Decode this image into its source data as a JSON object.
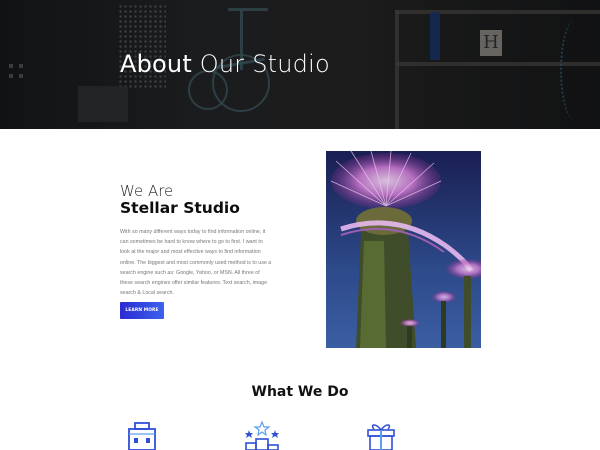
{
  "hero": {
    "title_bold": "About",
    "title_rest": " Our Studio"
  },
  "about": {
    "eyebrow": "We Are",
    "name": "Stellar Studio",
    "description": "With so many different ways today to find information online, it can sometimes be hard to know where to go to first. I want to look at the major and most effective ways to find information online. The biggest and most commonly used method is to use a search engine such as: Google, Yahoo, or MSN. All three of these search engines offer similar features: Text search, image search & Local search.",
    "button_label": "LEARN MORE"
  },
  "services": {
    "title": "What We Do",
    "icons": [
      "building-icon",
      "awards-podium-icon",
      "gift-box-icon"
    ]
  },
  "colors": {
    "accent_start": "#2b2bd1",
    "accent_end": "#3d62ee",
    "icon_blue": "#2f4fd8",
    "icon_light_blue": "#5aa0f0"
  }
}
